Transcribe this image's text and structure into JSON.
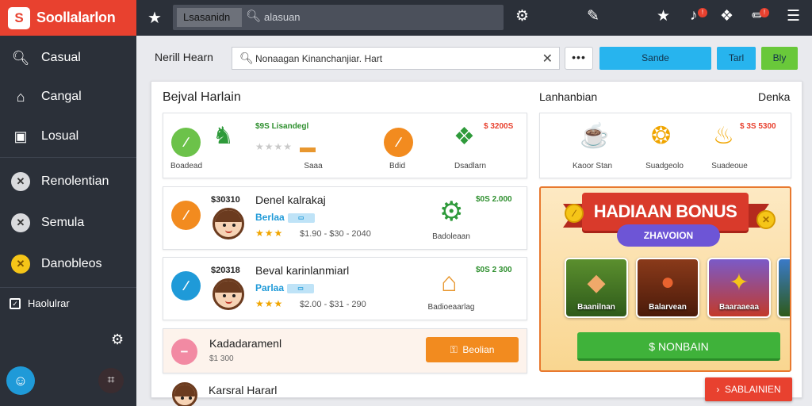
{
  "app": {
    "brand": "Soollalarlon",
    "brand_logo": "S"
  },
  "sidebar": {
    "items": [
      {
        "label": "Casual",
        "icon": "search-icon"
      },
      {
        "label": "Cangal",
        "icon": "home-icon"
      },
      {
        "label": "Losual",
        "icon": "inbox-icon"
      },
      {
        "label": "Renolentian",
        "icon": "x-circle-icon"
      },
      {
        "label": "Semula",
        "icon": "x-circle-icon"
      },
      {
        "label": "Danobleos",
        "icon": "coin-icon"
      }
    ],
    "footer_label": "Haolulrar"
  },
  "topbar": {
    "tab_label": "Lsasanidn",
    "search_text": "alasuan"
  },
  "toolbar": {
    "page_title": "Nerill Hearn",
    "search_value": "Nonaagan Kinanchanjiar. Hart",
    "more_label": "•••",
    "btn_primary": "Sande",
    "btn_secondary": "Tarl",
    "btn_green": "Bly"
  },
  "section_left": {
    "title": "Bejval Harlain",
    "top_card": {
      "items": [
        {
          "caption": "Boadead"
        },
        {
          "caption": "Saaa",
          "price": "$9S Lisandegl"
        },
        {
          "caption": "Bdid"
        },
        {
          "caption": "Dsadlarn",
          "price": "$ 3200S"
        }
      ]
    },
    "rows": [
      {
        "price": "$30310",
        "title": "Denel kalrakaj",
        "subtitle": "Berlaa",
        "meta": "$1.90 - $30 - 2040",
        "right_price": "$0S 2.000",
        "right_caption": "Badoleaan"
      },
      {
        "price": "$20318",
        "title": "Beval karinlanmiarl",
        "subtitle": "Parlaa",
        "meta": "$2.00 - $31 - 290",
        "right_price": "$0S 2 300",
        "right_caption": "Badioeaarlag"
      }
    ],
    "promo": {
      "title": "Kadadaramenl",
      "price": "$1 300",
      "button": "Beolian"
    },
    "bottom_row_title": "Karsral Hararl"
  },
  "section_right": {
    "title": "Lanhanbian",
    "link": "Denka",
    "items": [
      {
        "caption": "Kaoor Stan"
      },
      {
        "caption": "Suadgeolo"
      },
      {
        "caption": "Suadeoue",
        "price": "$ 3S 5300"
      }
    ]
  },
  "bonus": {
    "title": "HADIAAN BONUS",
    "pill": "ZHAVOION",
    "foods": [
      {
        "label": "Baanilnan"
      },
      {
        "label": "Balarvean"
      },
      {
        "label": "Baaraaeaa"
      }
    ],
    "cta": "$ NONBAIN"
  },
  "float_button": "SABLAINIEN",
  "colors": {
    "brand": "#e8412f",
    "accent": "#1f9ad8",
    "cta_green": "#3fb23a",
    "bonus_red": "#d93a2b"
  }
}
